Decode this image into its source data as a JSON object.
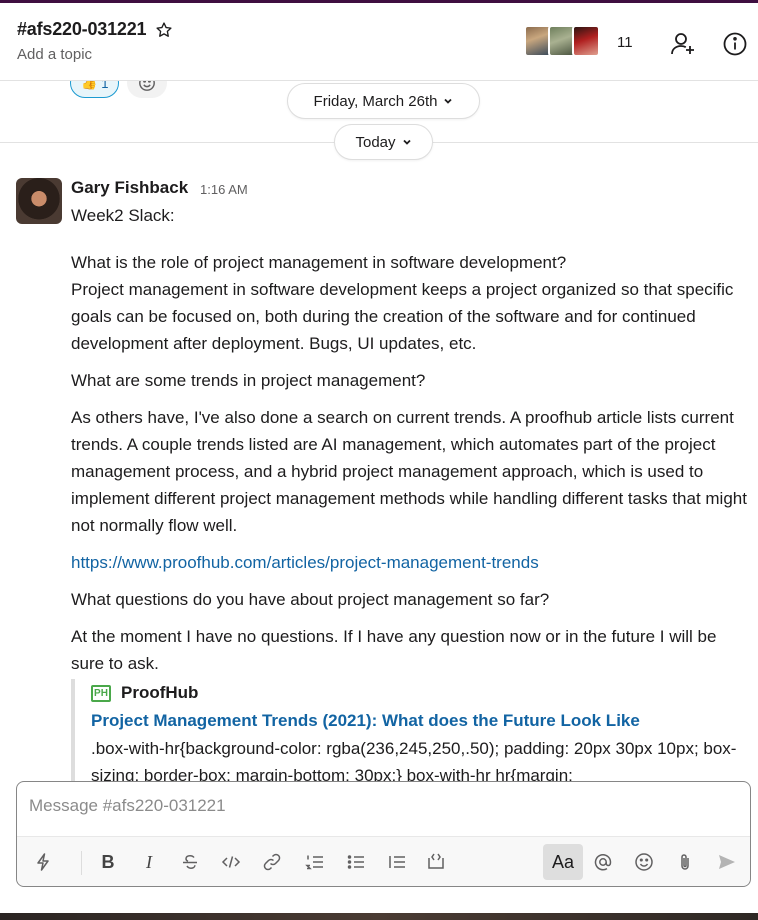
{
  "header": {
    "channel_name": "#afs220-031221",
    "topic_placeholder": "Add a topic",
    "member_count": "11",
    "icons": [
      "star-icon",
      "add-member-icon",
      "info-icon"
    ]
  },
  "reactions": [
    {
      "emoji": "👍",
      "count": "1"
    }
  ],
  "dividers": {
    "date_label": "Friday, March 26th",
    "today_label": "Today"
  },
  "message": {
    "sender": "Gary Fishback",
    "time": "1:16 AM",
    "paragraphs": [
      "Week2 Slack:",
      "What is the role of project management in software development?\nProject management in software development keeps a project organized so that specific goals can be focused on, both during the creation of the software and for continued development after deployment. Bugs, UI updates, etc.",
      "What are some trends in project management?",
      "As others have, I've also done a search on current trends. A proofhub article lists current trends. A couple trends listed are AI management, which automates part of the project management process, and a hybrid project management approach, which is used to implement different project management methods while handling different tasks that might not normally flow well.",
      "https://www.proofhub.com/articles/project-management-trends",
      "What questions do you have about project management so far?",
      "At the moment I have no questions. If I have any question now or in the future I will be sure to ask."
    ]
  },
  "unfurl": {
    "logo_text": "PH",
    "site": "ProofHub",
    "title": "Project Management Trends (2021): What does the Future Look Like",
    "description": ".box-with-hr{background-color: rgba(236,245,250,.50); padding: 20px 30px 10px; box-sizing: border-box; margin-bottom: 30px;} box-with-hr hr{margin:"
  },
  "composer": {
    "placeholder": "Message #afs220-031221",
    "format_label": "Aa"
  },
  "colors": {
    "link": "#1264a3",
    "aubergine": "#3f0e40"
  }
}
